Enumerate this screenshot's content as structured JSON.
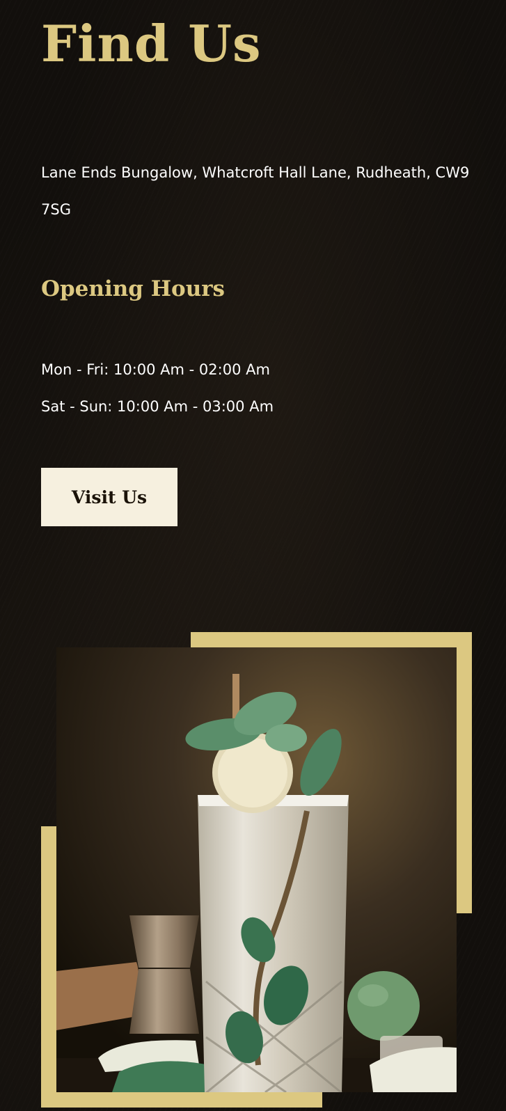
{
  "section": {
    "title": "Find Us",
    "address": "Lane Ends Bungalow, Whatcroft Hall Lane, Rudheath, CW9 7SG"
  },
  "opening_hours": {
    "heading": "Opening Hours",
    "lines": [
      "Mon - Fri: 10:00 Am - 02:00 Am",
      "Sat - Sun: 10:00 Am - 03:00 Am"
    ]
  },
  "cta": {
    "label": "Visit Us"
  },
  "colors": {
    "background": "#120f0c",
    "accent_gold": "#dcc881",
    "button_bg": "#f6f0df",
    "button_text": "#1a1208",
    "body_text": "#ffffff"
  },
  "image": {
    "subject_icon": "cocktail-glass-photo"
  }
}
